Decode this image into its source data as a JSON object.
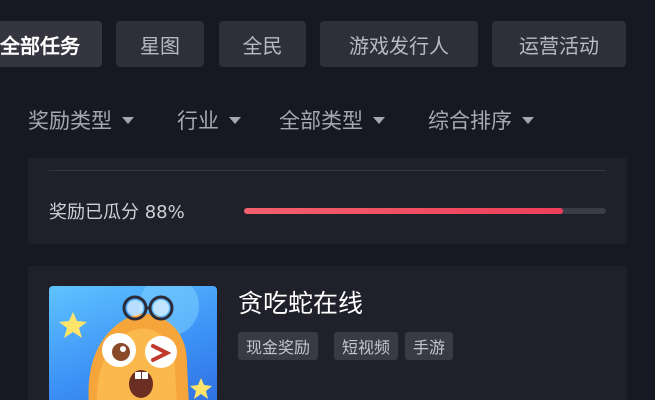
{
  "tabs": [
    {
      "label": "全部任务",
      "active": true
    },
    {
      "label": "星图",
      "active": false
    },
    {
      "label": "全民",
      "active": false
    },
    {
      "label": "游戏发行人",
      "active": false
    },
    {
      "label": "运营活动",
      "active": false
    }
  ],
  "filters": [
    {
      "label": "奖励类型",
      "icon": "caret-down-icon"
    },
    {
      "label": "行业",
      "icon": "caret-down-icon"
    },
    {
      "label": "全部类型",
      "icon": "caret-down-icon"
    },
    {
      "label": "综合排序",
      "icon": "caret-down-icon"
    }
  ],
  "reward": {
    "text": "奖励已瓜分 88%",
    "progress": 0.88,
    "color": "#ee3f5a"
  },
  "task": {
    "title": "贪吃蛇在线",
    "tags": [
      "现金奖励",
      "短视频",
      "手游"
    ],
    "thumbnail": "snake-game-character-image"
  },
  "colors": {
    "background": "#161823",
    "card": "#1f2029",
    "tab": "#2e2f3a",
    "accent": "#ee3f5a"
  }
}
